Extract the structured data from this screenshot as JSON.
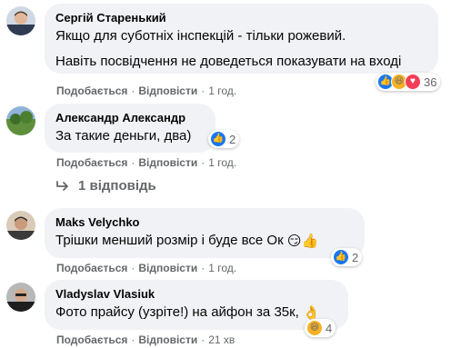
{
  "labels": {
    "like": "Подобається",
    "reply": "Відповісти",
    "separator": "·"
  },
  "comments": [
    {
      "author": "Сергій Старенький",
      "lines": [
        "Якщо для суботніх інспекцій - тільки рожевий.",
        "Навіть посвідчення не доведеться показувати на вході"
      ],
      "time": "1 год.",
      "reactions": [
        "like",
        "haha",
        "love"
      ],
      "reaction_count": "36"
    },
    {
      "author": "Александр Александр",
      "lines": [
        "За такие деньги, два)"
      ],
      "time": "1 год.",
      "reactions": [
        "like"
      ],
      "reaction_count": "2"
    },
    {
      "author": "Maks Velychko",
      "lines": [
        "Трішки менший розмір і буде все Ок"
      ],
      "time": "1 год.",
      "reactions": [
        "like"
      ],
      "reaction_count": "2",
      "emoji": [
        "😏",
        "👍"
      ]
    },
    {
      "author": "Vladyslav Vlasiuk",
      "lines": [
        "Фото прайсу (узріте!) на айфон за 35к,"
      ],
      "time": "21 хв",
      "reactions": [
        "haha"
      ],
      "reaction_count": "4",
      "emoji": [
        "👌"
      ]
    }
  ],
  "replies_link": "1 відповідь",
  "colors": {
    "bubble": "#f0f2f5",
    "meta": "#65676b",
    "like": "#1877f2",
    "haha": "#f7b125",
    "love": "#f33e58"
  },
  "icons": {
    "like": "thumbs-up-icon",
    "haha": "laughing-face-icon",
    "love": "heart-icon",
    "reply_arrow": "reply-arrow-icon"
  }
}
